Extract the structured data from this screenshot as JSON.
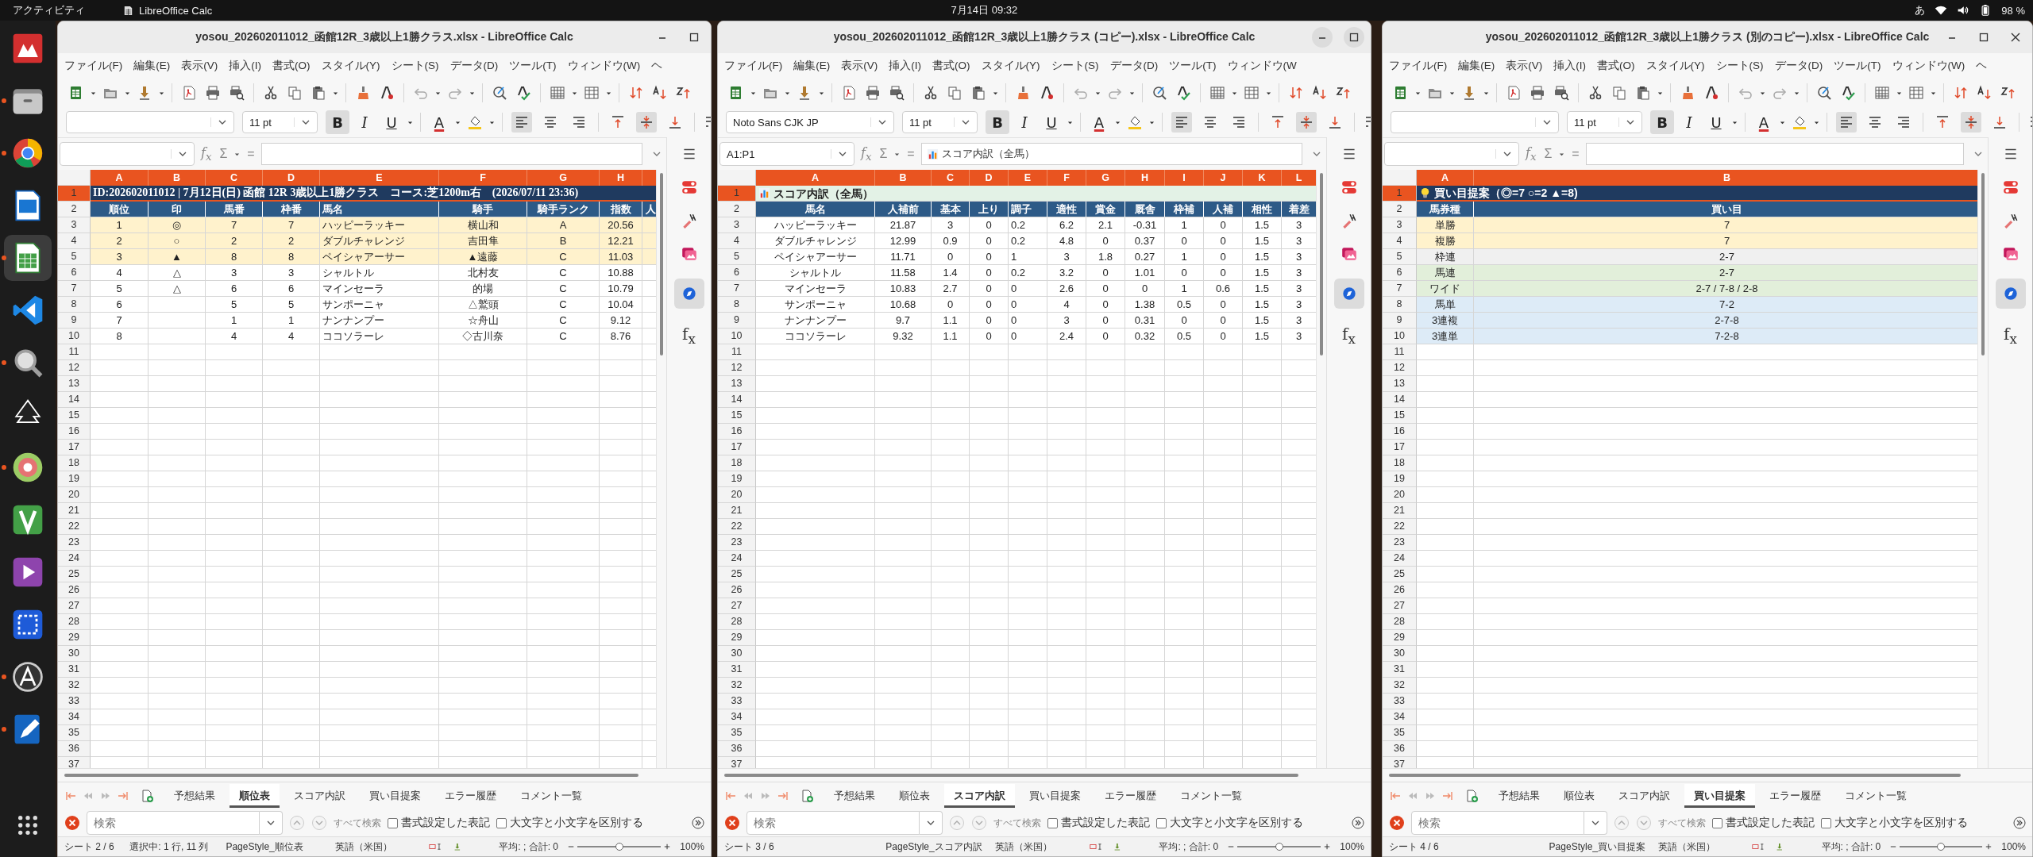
{
  "top_bar": {
    "activities": "アクティビティ",
    "app_name": "LibreOffice Calc",
    "clock": "7月14日  09:32",
    "input_method": "あ",
    "battery": "98 %"
  },
  "dock": [
    {
      "kind": "pdf",
      "running": false,
      "selected": false
    },
    {
      "kind": "files",
      "running": true,
      "selected": false
    },
    {
      "kind": "browser",
      "running": true,
      "selected": false
    },
    {
      "kind": "slides",
      "running": false,
      "selected": false
    },
    {
      "kind": "calc",
      "running": true,
      "selected": true
    },
    {
      "kind": "code",
      "running": false,
      "selected": false
    },
    {
      "kind": "magnifier",
      "running": true,
      "selected": false
    },
    {
      "kind": "inkscape",
      "running": false,
      "selected": false
    },
    {
      "kind": "disc",
      "running": true,
      "selected": false
    },
    {
      "kind": "vim",
      "running": false,
      "selected": false
    },
    {
      "kind": "video",
      "running": false,
      "selected": false
    },
    {
      "kind": "screenshot",
      "running": false,
      "selected": false
    },
    {
      "kind": "accessibility",
      "running": true,
      "selected": false
    },
    {
      "kind": "editor",
      "running": true,
      "selected": false
    }
  ],
  "windows": [
    {
      "title": "yosou_202602011012_函館12R_3歳以上1勝クラス.xlsx - LibreOffice Calc",
      "focused": false,
      "close_button": false,
      "menu": [
        "ファイル(F)",
        "編集(E)",
        "表示(V)",
        "挿入(I)",
        "書式(O)",
        "スタイル(Y)",
        "シート(S)",
        "データ(D)",
        "ツール(T)",
        "ウィンドウ(W)",
        "ヘ"
      ],
      "font": {
        "size": "11 pt"
      },
      "format": {
        "bold": {
          "label": "B",
          "on": true
        },
        "italic": {
          "label": "I",
          "on": false
        },
        "underline": {
          "label": "U",
          "on": false
        },
        "font_color": "A"
      },
      "align_buttons": [
        {
          "selected": true
        },
        {
          "selected": false
        },
        {
          "selected": false
        }
      ],
      "valign_buttons": [
        {
          "selected": false
        },
        {
          "selected": true
        },
        {
          "selected": false
        }
      ],
      "formula": {
        "fx": "f$_{x}$",
        "sum": "Σ",
        "equals": "="
      },
      "sidebar_fx": "f$_{x}$",
      "columns": [
        {
          "label": "A",
          "selected": true
        },
        {
          "label": "B",
          "selected": true
        },
        {
          "label": "C",
          "selected": true
        },
        {
          "label": "D",
          "selected": true
        },
        {
          "label": "E",
          "selected": true
        },
        {
          "label": "F",
          "selected": true
        },
        {
          "label": "G",
          "selected": true
        },
        {
          "label": "H",
          "selected": true
        }
      ],
      "rows": [
        {
          "kind": "title",
          "selected": true,
          "cells": [
            "ID:202602011012 | 7月12日(日) 函館 12R 3歳以上1勝クラス　コース:芝1200m右　(2026/07/11 23:36)"
          ]
        },
        {
          "kind": "header",
          "selected": false,
          "cells": [
            "順位",
            "印",
            "馬番",
            "枠番",
            "馬名",
            "騎手",
            "騎手ランク",
            "指数",
            "人"
          ]
        },
        {
          "kind": "yellow",
          "selected": false,
          "cells": [
            "1",
            "◎",
            "7",
            "7",
            "ハッピーラッキー",
            "横山和",
            "A",
            "20.56"
          ]
        },
        {
          "kind": "yellow",
          "selected": false,
          "cells": [
            "2",
            "○",
            "2",
            "2",
            "ダブルチャレンジ",
            "吉田隼",
            "B",
            "12.21"
          ]
        },
        {
          "kind": "yellow",
          "selected": false,
          "cells": [
            "3",
            "▲",
            "8",
            "8",
            "ペイシャアーサー",
            "▲遠藤",
            "C",
            "11.03"
          ]
        },
        {
          "kind": "plain",
          "selected": false,
          "cells": [
            "4",
            "△",
            "3",
            "3",
            "シャルトル",
            "北村友",
            "C",
            "10.88"
          ]
        },
        {
          "kind": "plain",
          "selected": false,
          "cells": [
            "5",
            "△",
            "6",
            "6",
            "マインセーラ",
            "的場",
            "C",
            "10.79"
          ]
        },
        {
          "kind": "plain",
          "selected": false,
          "cells": [
            "6",
            null,
            "5",
            "5",
            "サンポーニャ",
            "△鷲頭",
            "C",
            "10.04"
          ]
        },
        {
          "kind": "plain",
          "selected": false,
          "cells": [
            "7",
            null,
            "1",
            "1",
            "ナンナンプー",
            "☆舟山",
            "C",
            "9.12"
          ]
        },
        {
          "kind": "plain",
          "selected": false,
          "cells": [
            "8",
            null,
            "4",
            "4",
            "ココソラーレ",
            "◇古川奈",
            "C",
            "8.76"
          ]
        }
      ],
      "row_numbers": [
        "1",
        "2",
        "3",
        "4",
        "5",
        "6",
        "7",
        "8",
        "9",
        "10",
        "11",
        "12",
        "13",
        "14",
        "15",
        "16",
        "17",
        "18",
        "19",
        "20",
        "21",
        "22",
        "23",
        "24",
        "25",
        "26",
        "27",
        "28",
        "29",
        "30",
        "31",
        "32",
        "33",
        "34",
        "35",
        "36",
        "37"
      ],
      "tabs": [
        {
          "label": "予想結果",
          "selected": false
        },
        {
          "label": "順位表",
          "selected": true
        },
        {
          "label": "スコア内訳",
          "selected": false
        },
        {
          "label": "買い目提案",
          "selected": false
        },
        {
          "label": "エラー履歴",
          "selected": false
        },
        {
          "label": "コメント一覧",
          "selected": false
        }
      ],
      "find": {
        "placeholder": "検索",
        "find_all": "すべて検索",
        "options": [
          {
            "label": "書式設定した表記",
            "checked": false
          },
          {
            "label": "大文字と小文字を区別する",
            "checked": false
          }
        ]
      },
      "status": {
        "sheet": "シート 2 / 6",
        "selection": "選択中: 1 行, 11 列",
        "page_style": "PageStyle_順位表",
        "language": "英語（米国）",
        "sum": "平均: ; 合計: 0",
        "zoom": {
          "level": 0.5,
          "label": "100%"
        }
      }
    },
    {
      "title": "yosou_202602011012_函館12R_3歳以上1勝クラス (コピー).xlsx - LibreOffice Calc",
      "focused": true,
      "close_button": false,
      "menu": [
        "ファイル(F)",
        "編集(E)",
        "表示(V)",
        "挿入(I)",
        "書式(O)",
        "スタイル(Y)",
        "シート(S)",
        "データ(D)",
        "ツール(T)",
        "ウィンドウ(W"
      ],
      "font": {
        "name": "Noto Sans CJK JP",
        "size": "11 pt"
      },
      "format": {
        "bold": {
          "label": "B",
          "on": true
        },
        "italic": {
          "label": "I",
          "on": false
        },
        "underline": {
          "label": "U",
          "on": false
        },
        "font_color": "A"
      },
      "align_buttons": [
        {
          "selected": true
        },
        {
          "selected": false
        },
        {
          "selected": false
        }
      ],
      "valign_buttons": [
        {
          "selected": false
        },
        {
          "selected": true
        },
        {
          "selected": false
        }
      ],
      "formula": {
        "fx": "f$_{x}$",
        "sum": "Σ",
        "equals": "=",
        "name_box": "A1:P1",
        "kind": "chart",
        "text": "スコア内訳（全馬）"
      },
      "sidebar_fx": "f$_{x}$",
      "columns": [
        {
          "label": "A",
          "selected": true
        },
        {
          "label": "B",
          "selected": true
        },
        {
          "label": "C",
          "selected": true
        },
        {
          "label": "D",
          "selected": true
        },
        {
          "label": "E",
          "selected": true
        },
        {
          "label": "F",
          "selected": true
        },
        {
          "label": "G",
          "selected": true
        },
        {
          "label": "H",
          "selected": true
        },
        {
          "label": "I",
          "selected": true
        },
        {
          "label": "J",
          "selected": true
        },
        {
          "label": "K",
          "selected": true
        },
        {
          "label": "L",
          "selected": true
        }
      ],
      "rows": [
        {
          "kind": "section",
          "selected": true,
          "cells": [
            "スコア内訳（全馬）"
          ]
        },
        {
          "kind": "header",
          "selected": false,
          "cells": [
            "馬名",
            "人補前",
            "基本",
            "上り",
            "調子",
            "適性",
            "賞金",
            "厩舎",
            "枠補",
            "人補",
            "相性",
            "着差"
          ]
        },
        {
          "kind": "plain",
          "selected": false,
          "cells": [
            "ハッピーラッキー",
            "21.87",
            "3",
            "0",
            "0.2",
            "6.2",
            "2.1",
            "-0.31",
            "1",
            "0",
            "1.5",
            "3"
          ]
        },
        {
          "kind": "plain",
          "selected": false,
          "cells": [
            "ダブルチャレンジ",
            "12.99",
            "0.9",
            "0",
            "0.2",
            "4.8",
            "0",
            "0.37",
            "0",
            "0",
            "1.5",
            "3"
          ]
        },
        {
          "kind": "plain",
          "selected": false,
          "cells": [
            "ペイシャアーサー",
            "11.71",
            "0",
            "0",
            "1",
            "3",
            "1.8",
            "0.27",
            "1",
            "0",
            "1.5",
            "3"
          ]
        },
        {
          "kind": "plain",
          "selected": false,
          "cells": [
            "シャルトル",
            "11.58",
            "1.4",
            "0",
            "0.2",
            "3.2",
            "0",
            "1.01",
            "0",
            "0",
            "1.5",
            "3"
          ]
        },
        {
          "kind": "plain",
          "selected": false,
          "cells": [
            "マインセーラ",
            "10.83",
            "2.7",
            "0",
            "0",
            "2.6",
            "0",
            "0",
            "1",
            "0.6",
            "1.5",
            "3"
          ]
        },
        {
          "kind": "plain",
          "selected": false,
          "cells": [
            "サンポーニャ",
            "10.68",
            "0",
            "0",
            "0",
            "4",
            "0",
            "1.38",
            "0.5",
            "0",
            "1.5",
            "3"
          ]
        },
        {
          "kind": "plain",
          "selected": false,
          "cells": [
            "ナンナンプー",
            "9.7",
            "1.1",
            "0",
            "0",
            "3",
            "0",
            "0.31",
            "0",
            "0",
            "1.5",
            "3"
          ]
        },
        {
          "kind": "plain",
          "selected": false,
          "cells": [
            "ココソラーレ",
            "9.32",
            "1.1",
            "0",
            "0",
            "2.4",
            "0",
            "0.32",
            "0.5",
            "0",
            "1.5",
            "3"
          ]
        }
      ],
      "row_numbers": [
        "1",
        "2",
        "3",
        "4",
        "5",
        "6",
        "7",
        "8",
        "9",
        "10",
        "11",
        "12",
        "13",
        "14",
        "15",
        "16",
        "17",
        "18",
        "19",
        "20",
        "21",
        "22",
        "23",
        "24",
        "25",
        "26",
        "27",
        "28",
        "29",
        "30",
        "31",
        "32",
        "33",
        "34",
        "35",
        "36",
        "37"
      ],
      "tabs": [
        {
          "label": "予想結果",
          "selected": false
        },
        {
          "label": "順位表",
          "selected": false
        },
        {
          "label": "スコア内訳",
          "selected": true
        },
        {
          "label": "買い目提案",
          "selected": false
        },
        {
          "label": "エラー履歴",
          "selected": false
        },
        {
          "label": "コメント一覧",
          "selected": false
        }
      ],
      "find": {
        "placeholder": "検索",
        "find_all": "すべて検索",
        "options": [
          {
            "label": "書式設定した表記",
            "checked": false
          },
          {
            "label": "大文字と小文字を区別する",
            "checked": false
          }
        ]
      },
      "status": {
        "sheet": "シート 3 / 6",
        "page_style": "PageStyle_スコア内訳",
        "language": "英語（米国）",
        "sum": "平均: ; 合計: 0",
        "zoom": {
          "level": 0.5,
          "label": "100%"
        }
      }
    },
    {
      "title": "yosou_202602011012_函館12R_3歳以上1勝クラス (別のコピー).xlsx - LibreOffice Calc",
      "focused": false,
      "close_button": true,
      "menu": [
        "ファイル(F)",
        "編集(E)",
        "表示(V)",
        "挿入(I)",
        "書式(O)",
        "スタイル(Y)",
        "シート(S)",
        "データ(D)",
        "ツール(T)",
        "ウィンドウ(W)",
        "ヘ"
      ],
      "font": {
        "size": "11 pt"
      },
      "format": {
        "bold": {
          "label": "B",
          "on": true
        },
        "italic": {
          "label": "I",
          "on": false
        },
        "underline": {
          "label": "U",
          "on": false
        },
        "font_color": "A"
      },
      "align_buttons": [
        {
          "selected": true
        },
        {
          "selected": false
        },
        {
          "selected": false
        }
      ],
      "valign_buttons": [
        {
          "selected": false
        },
        {
          "selected": true
        },
        {
          "selected": false
        }
      ],
      "formula": {
        "fx": "f$_{x}$",
        "sum": "Σ",
        "equals": "="
      },
      "sidebar_fx": "f$_{x}$",
      "columns": [
        {
          "label": "A",
          "selected": true
        },
        {
          "label": "B",
          "selected": true
        }
      ],
      "rows": [
        {
          "kind": "banner",
          "selected": true,
          "cells": [
            "買い目提案（◎=7 ○=2 ▲=8)"
          ]
        },
        {
          "kind": "header",
          "selected": false,
          "cells": [
            "馬券種",
            "買い目"
          ]
        },
        {
          "kind": "yellow",
          "selected": false,
          "cells": [
            "単勝",
            "7"
          ]
        },
        {
          "kind": "yellow",
          "selected": false,
          "cells": [
            "複勝",
            "7"
          ]
        },
        {
          "kind": "gray",
          "selected": false,
          "cells": [
            "枠連",
            "2-7"
          ]
        },
        {
          "kind": "green",
          "selected": false,
          "cells": [
            "馬連",
            "2-7"
          ]
        },
        {
          "kind": "green",
          "selected": false,
          "cells": [
            "ワイド",
            "2-7 / 7-8 / 2-8"
          ]
        },
        {
          "kind": "blue",
          "selected": false,
          "cells": [
            "馬単",
            "7-2"
          ]
        },
        {
          "kind": "blue",
          "selected": false,
          "cells": [
            "3連複",
            "2-7-8"
          ]
        },
        {
          "kind": "blue",
          "selected": false,
          "cells": [
            "3連単",
            "7-2-8"
          ]
        }
      ],
      "row_numbers": [
        "1",
        "2",
        "3",
        "4",
        "5",
        "6",
        "7",
        "8",
        "9",
        "10",
        "11",
        "12",
        "13",
        "14",
        "15",
        "16",
        "17",
        "18",
        "19",
        "20",
        "21",
        "22",
        "23",
        "24",
        "25",
        "26",
        "27",
        "28",
        "29",
        "30",
        "31",
        "32",
        "33",
        "34",
        "35",
        "36",
        "37"
      ],
      "tabs": [
        {
          "label": "予想結果",
          "selected": false
        },
        {
          "label": "順位表",
          "selected": false
        },
        {
          "label": "スコア内訳",
          "selected": false
        },
        {
          "label": "買い目提案",
          "selected": true
        },
        {
          "label": "エラー履歴",
          "selected": false
        },
        {
          "label": "コメント一覧",
          "selected": false
        }
      ],
      "find": {
        "placeholder": "検索",
        "find_all": "すべて検索",
        "options": [
          {
            "label": "書式設定した表記",
            "checked": false
          },
          {
            "label": "大文字と小文字を区別する",
            "checked": false
          }
        ]
      },
      "status": {
        "sheet": "シート 4 / 6",
        "page_style": "PageStyle_買い目提案",
        "language": "英語（米国）",
        "sum": "平均: ; 合計: 0",
        "zoom": {
          "level": 0.5,
          "label": "100%"
        }
      }
    }
  ]
}
